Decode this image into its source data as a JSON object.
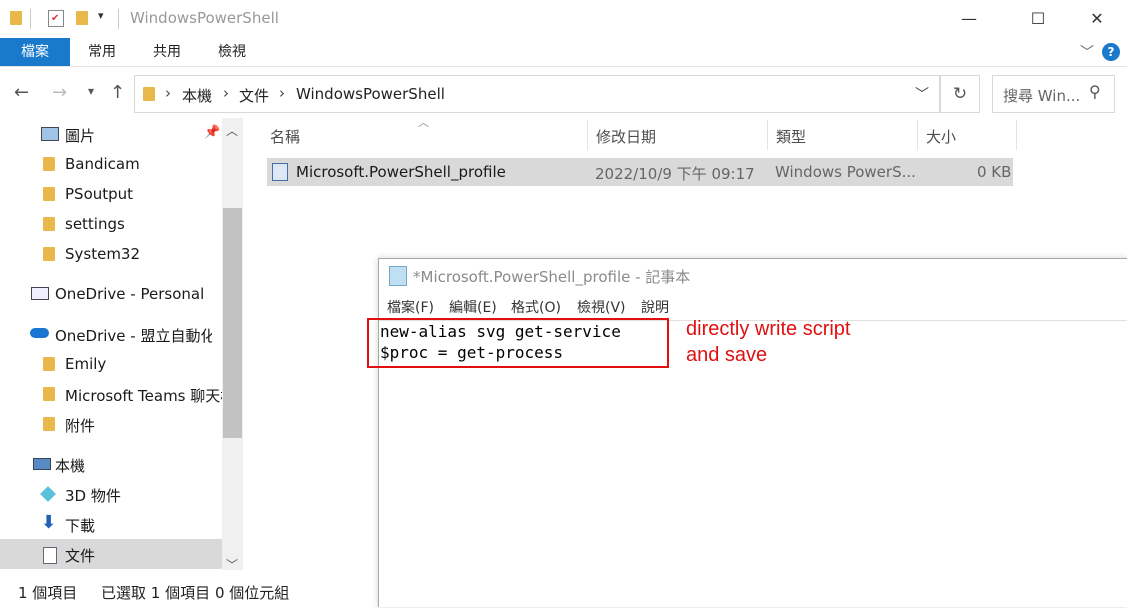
{
  "window": {
    "title": "WindowsPowerShell",
    "controls": {
      "minimize": "—",
      "maximize": "☐",
      "close": "✕"
    }
  },
  "ribbon": {
    "tabs": [
      "檔案",
      "常用",
      "共用",
      "檢視"
    ],
    "active_tab": "檔案",
    "help": "?"
  },
  "address": {
    "breadcrumbs": [
      "本機",
      "文件",
      "WindowsPowerShell"
    ],
    "search_placeholder": "搜尋 Win..."
  },
  "nav_pane": {
    "items": [
      {
        "label": "圖片",
        "icon": "pictures-icon",
        "pinned": true
      },
      {
        "label": "Bandicam",
        "icon": "folder-icon"
      },
      {
        "label": "PSoutput",
        "icon": "folder-icon"
      },
      {
        "label": "settings",
        "icon": "folder-icon"
      },
      {
        "label": "System32",
        "icon": "folder-icon"
      },
      {
        "label": "OneDrive - Personal",
        "icon": "onedrive-personal-icon"
      },
      {
        "label": "OneDrive - 盟立自動化股",
        "icon": "onedrive-cloud-icon"
      },
      {
        "label": "Emily",
        "icon": "folder-icon"
      },
      {
        "label": "Microsoft Teams 聊天檔",
        "icon": "folder-icon"
      },
      {
        "label": "附件",
        "icon": "folder-icon"
      },
      {
        "label": "本機",
        "icon": "this-pc-icon"
      },
      {
        "label": "3D 物件",
        "icon": "3d-objects-icon"
      },
      {
        "label": "下載",
        "icon": "download-icon"
      },
      {
        "label": "文件",
        "icon": "documents-icon",
        "selected": true
      }
    ]
  },
  "file_list": {
    "columns": [
      "名稱",
      "修改日期",
      "類型",
      "大小"
    ],
    "rows": [
      {
        "name": "Microsoft.PowerShell_profile",
        "modified": "2022/10/9 下午 09:17",
        "type": "Windows PowerS...",
        "size": "0 KB"
      }
    ]
  },
  "status_bar": {
    "count": "1 個項目",
    "selected": "已選取 1 個項目",
    "size": "0 個位元組"
  },
  "notepad": {
    "title": "*Microsoft.PowerShell_profile - 記事本",
    "menu": [
      "檔案(F)",
      "編輯(E)",
      "格式(O)",
      "檢視(V)",
      "說明"
    ],
    "lines": [
      "new-alias svg get-service",
      "$proc = get-process"
    ]
  },
  "annotation": {
    "line1": "directly write script",
    "line2": "and save",
    "color": "#e01010"
  }
}
